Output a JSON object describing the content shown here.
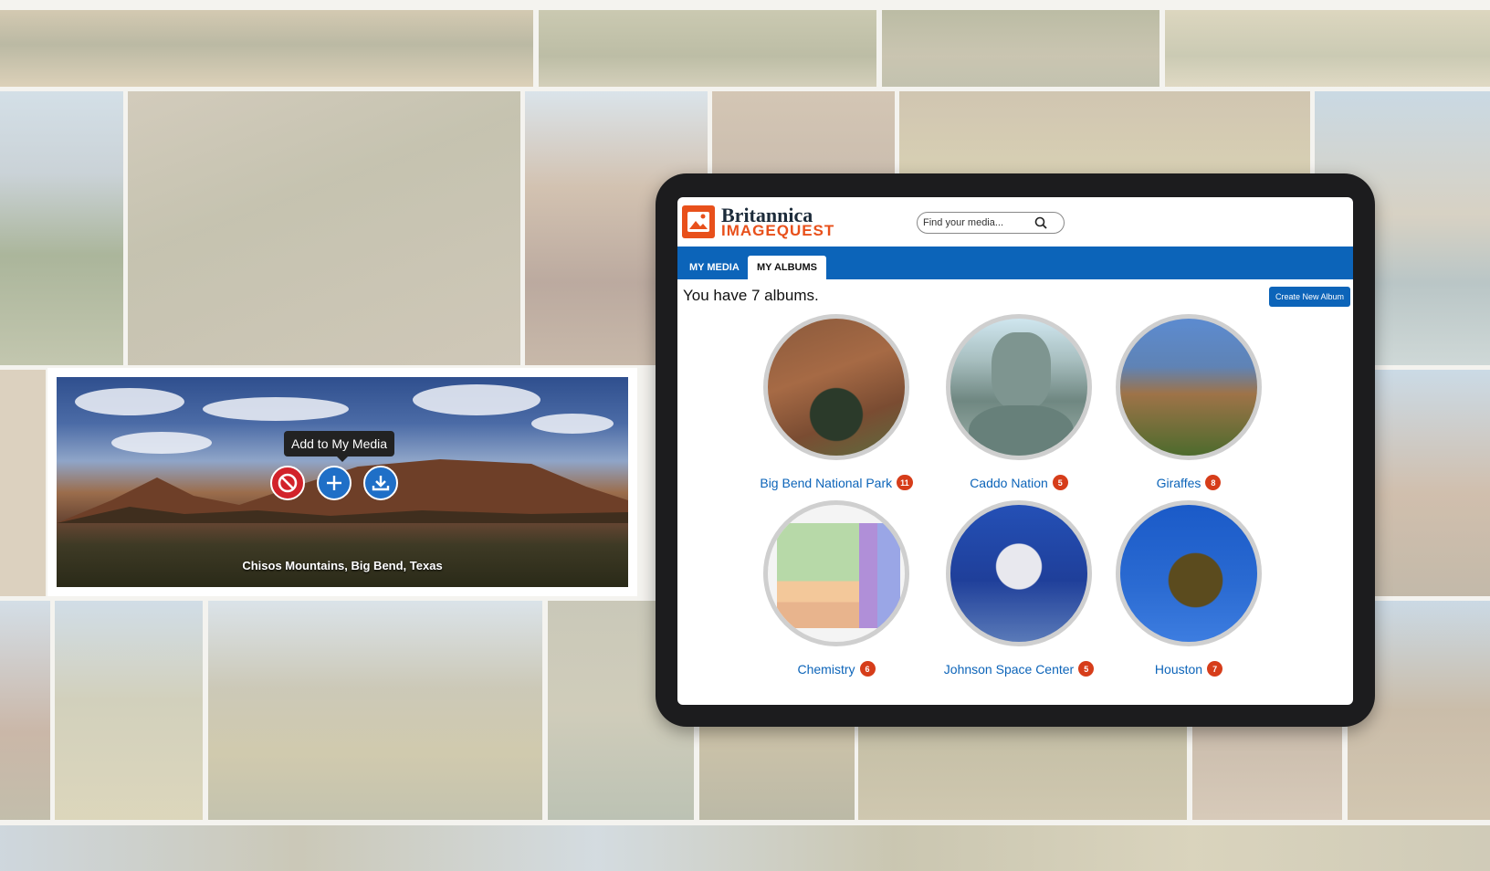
{
  "tooltip": "Add to My Media",
  "photo_caption": "Chisos Mountains, Big Bend, Texas",
  "photo_actions": {
    "block_icon": "block-icon",
    "add_icon": "plus-icon",
    "download_icon": "download-icon"
  },
  "brand": {
    "line1": "Britannica",
    "line2": "IMAGEQUEST",
    "logo_color": "#e8501b",
    "primary_color": "#0c64b9"
  },
  "search": {
    "placeholder": "Find your media...",
    "icon": "search-icon"
  },
  "tabs": [
    {
      "label": "MY MEDIA"
    },
    {
      "label": "MY ALBUMS"
    }
  ],
  "album_count_text": "You have 7 albums.",
  "create_button": "Create New Album",
  "albums": [
    {
      "name": "Big Bend National Park",
      "count": "11"
    },
    {
      "name": "Caddo Nation",
      "count": "5"
    },
    {
      "name": "Giraffes",
      "count": "8"
    },
    {
      "name": "Chemistry",
      "count": "6"
    },
    {
      "name": "Johnson Space Center",
      "count": "5"
    },
    {
      "name": "Houston",
      "count": "7"
    }
  ]
}
